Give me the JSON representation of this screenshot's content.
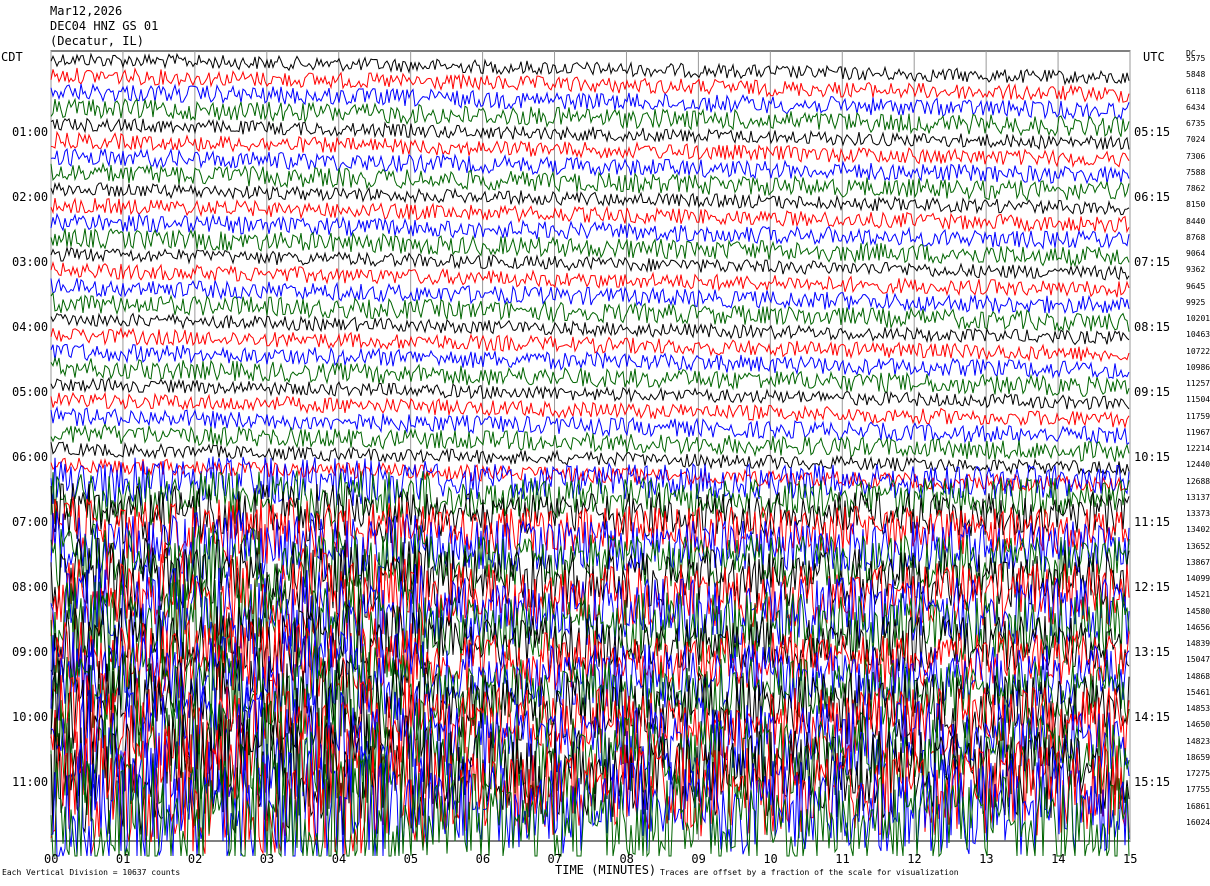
{
  "header": {
    "date": "Mar12,2026",
    "station": "DEC04 HNZ GS 01",
    "location": "(Decatur, IL)"
  },
  "left_axis_title": "CDT",
  "right_axis_title": "UTC",
  "dc_title": "DC",
  "xlabel": "TIME (MINUTES)",
  "footer": {
    "left": "Each Vertical Division = 10637 counts",
    "right": "Traces are offset by a fraction of the scale for visualization"
  },
  "colors": {
    "trace_cycle": [
      "#000000",
      "#ff0000",
      "#0000ff",
      "#006400"
    ]
  },
  "chart_data": {
    "type": "helicorder",
    "title": "DEC04 HNZ GS 01",
    "xlabel": "TIME (MINUTES)",
    "xlim": [
      0,
      15
    ],
    "x_ticks": [
      "00",
      "01",
      "02",
      "03",
      "04",
      "05",
      "06",
      "07",
      "08",
      "09",
      "10",
      "11",
      "12",
      "13",
      "14",
      "15"
    ],
    "left_time_labels": [
      "01:00",
      "02:00",
      "03:00",
      "04:00",
      "05:00",
      "06:00",
      "07:00",
      "08:00",
      "09:00",
      "10:00",
      "11:00"
    ],
    "right_time_labels": [
      "05:15",
      "06:15",
      "07:15",
      "08:15",
      "09:15",
      "10:15",
      "11:15",
      "12:15",
      "13:15",
      "14:15",
      "15:15"
    ],
    "dc_offsets": [
      "5575",
      "5848",
      "6118",
      "6434",
      "6735",
      "7024",
      "7306",
      "7588",
      "7862",
      "8150",
      "8440",
      "8768",
      "9064",
      "9362",
      "9645",
      "9925",
      "10201",
      "10463",
      "10722",
      "10986",
      "11257",
      "11504",
      "11759",
      "11967",
      "12214",
      "12440",
      "12688",
      "13137",
      "13373",
      "13402",
      "13652",
      "13867",
      "14099",
      "14521",
      "14580",
      "14656",
      "14839",
      "15047",
      "14868",
      "15461",
      "14853",
      "14650",
      "14823",
      "18659",
      "17275",
      "17755",
      "16861",
      "16024"
    ],
    "trace_colors_order": [
      "black",
      "red",
      "blue",
      "green"
    ],
    "scale": "10637 counts",
    "notes": "Stacked 15-minute traces; amplitude increases sharply after 07:00 CDT"
  }
}
